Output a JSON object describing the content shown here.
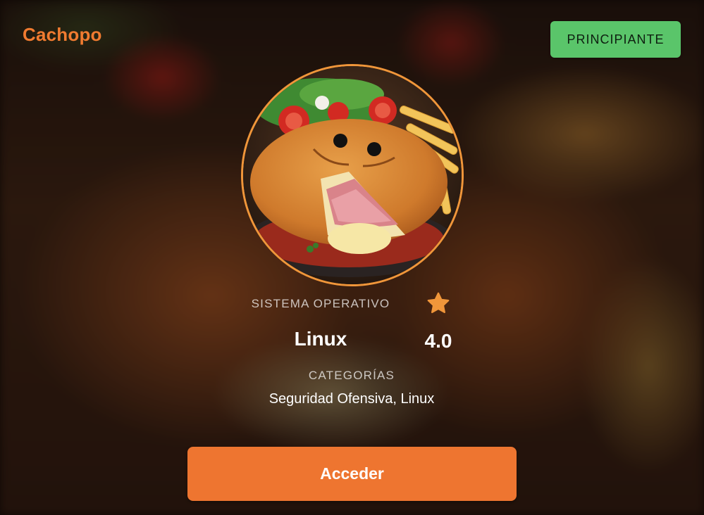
{
  "card": {
    "title": "Cachopo",
    "difficulty_badge": "PRINCIPIANTE",
    "image_subject": "cachopo-dish",
    "os_label": "SISTEMA OPERATIVO",
    "os_value": "Linux",
    "rating_icon": "star-icon",
    "rating_value": "4.0",
    "categories_label": "CATEGORÍAS",
    "categories_value": "Seguridad Ofensiva, Linux",
    "access_button": "Acceder"
  },
  "colors": {
    "title": "#f07b30",
    "badge_bg": "#5ac56a",
    "avatar_border": "#f0963a",
    "star": "#f0963a",
    "button_bg": "#ee7530"
  }
}
